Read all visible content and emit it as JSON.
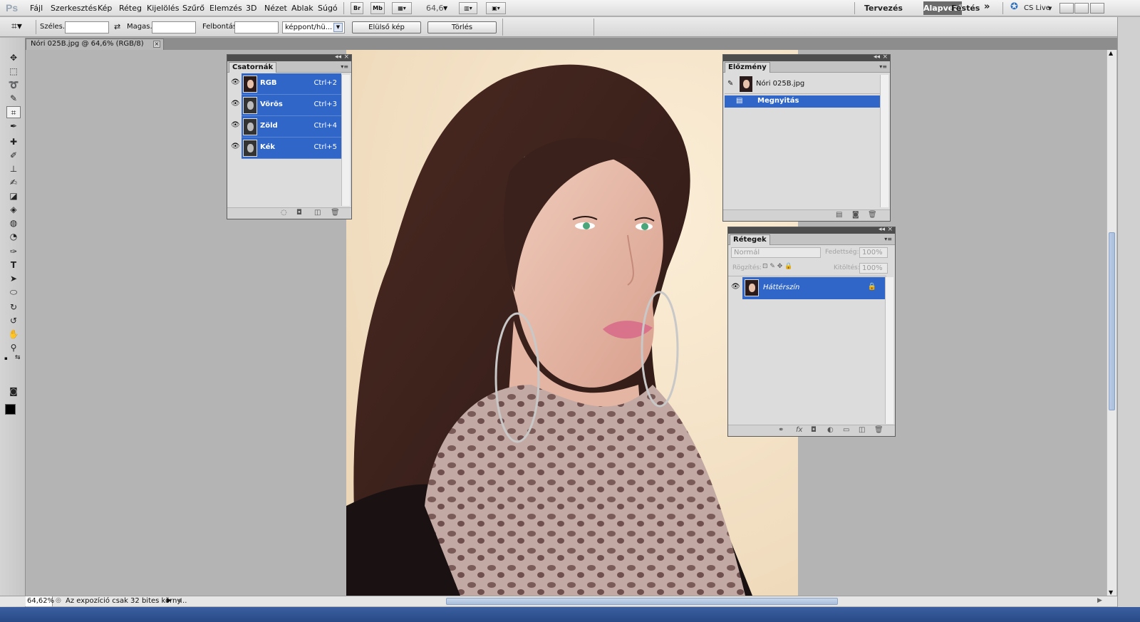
{
  "app": {
    "logo": "Ps"
  },
  "menu": [
    "Fájl",
    "Szerkesztés",
    "Kép",
    "Réteg",
    "Kijelölés",
    "Szűrő",
    "Elemzés",
    "3D",
    "Nézet",
    "Ablak",
    "Súgó"
  ],
  "appbar": {
    "btn_br": "Br",
    "btn_mb": "Mb",
    "zoom_value": "64,6"
  },
  "workspaces": {
    "ws1": "Tervezés",
    "ws2": "Alapvető",
    "ws3": "Festés",
    "more": "»",
    "cslive": "CS Live"
  },
  "options": {
    "width_label": "Széles.:",
    "width_value": "",
    "height_label": "Magas.:",
    "height_value": "",
    "resolution_label": "Felbontás:",
    "resolution_value": "",
    "unit": "képpont/hü...",
    "front_image": "Elülső kép",
    "clear": "Törlés"
  },
  "document": {
    "tab_title": "Nóri 025B.jpg @ 64,6% (RGB/8)"
  },
  "channels": {
    "tab": "Csatornák",
    "rows": [
      {
        "name": "RGB",
        "shortcut": "Ctrl+2"
      },
      {
        "name": "Vörös",
        "shortcut": "Ctrl+3"
      },
      {
        "name": "Zöld",
        "shortcut": "Ctrl+4"
      },
      {
        "name": "Kék",
        "shortcut": "Ctrl+5"
      }
    ]
  },
  "history": {
    "tab": "Előzmény",
    "snapshot": "Nóri 025B.jpg",
    "step": "Megnyitás"
  },
  "layers": {
    "tab": "Rétegek",
    "blend_mode": "Normál",
    "opacity_label": "Fedettség:",
    "opacity_value": "100%",
    "lock_label": "Rögzítés:",
    "fill_label": "Kitöltés:",
    "fill_value": "100%",
    "layer_name": "Háttérszín"
  },
  "status": {
    "zoom": "64,62%",
    "message": "Az expozíció csak 32 bites körny..."
  },
  "colors": {
    "selection": "#2f66c8",
    "panel_bg": "#dcdcdc",
    "workspace_bg": "#b4b4b4"
  }
}
